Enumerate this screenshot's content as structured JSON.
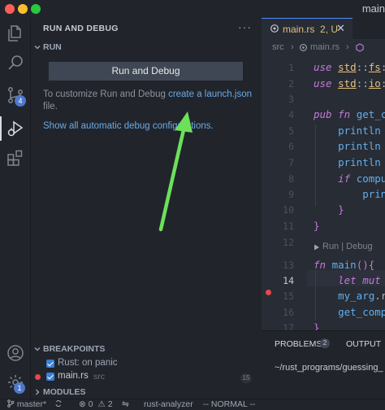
{
  "window": {
    "title": "main"
  },
  "activity": {
    "scm_badge": "4",
    "account_badge": "1"
  },
  "sidebar": {
    "header": "RUN AND DEBUG",
    "more": "···",
    "run_section": "RUN",
    "run_button": "Run and Debug",
    "desc_prefix": "To customize Run and Debug ",
    "desc_link": "create a launch.json",
    "desc_suffix": "file.",
    "show_link": "Show all automatic debug configurations.",
    "breakpoints_section": "BREAKPOINTS",
    "breakpoints": [
      {
        "label": "Rust: on panic",
        "checked": true
      },
      {
        "label": "main.rs",
        "path": "src",
        "line": "15",
        "checked": true
      }
    ],
    "modules_section": "MODULES"
  },
  "editor": {
    "tab": {
      "label": "main.rs",
      "status": "2, U",
      "close": "✕"
    },
    "breadcrumb": {
      "folder": "src",
      "sep": "›",
      "file": "main.rs",
      "sep2": "›"
    },
    "code_lens": "Run | Debug",
    "lines": [
      {
        "num": "1",
        "text": "use std::fs::"
      },
      {
        "num": "2",
        "text": "use std::io::"
      },
      {
        "num": "3",
        "text": ""
      },
      {
        "num": "4",
        "text": "pub fn get_c"
      },
      {
        "num": "5",
        "text": "    println"
      },
      {
        "num": "6",
        "text": "    println"
      },
      {
        "num": "7",
        "text": "    println"
      },
      {
        "num": "8",
        "text": "    if compu"
      },
      {
        "num": "9",
        "text": "        prin"
      },
      {
        "num": "10",
        "text": "    }"
      },
      {
        "num": "11",
        "text": "}"
      },
      {
        "num": "12",
        "text": ""
      },
      {
        "num": "13",
        "text": "fn main(){"
      },
      {
        "num": "14",
        "text": "    let mut"
      },
      {
        "num": "15",
        "text": "    my_arg.r"
      },
      {
        "num": "16",
        "text": "    get_comp"
      },
      {
        "num": "17",
        "text": "}"
      }
    ]
  },
  "panel": {
    "problems": "PROBLEMS",
    "problems_count": "2",
    "output": "OUTPUT",
    "terminal": "~/rust_programs/guessing_"
  },
  "status": {
    "branch": "master*",
    "errors": "0",
    "warnings": "2",
    "analyzer": "rust-analyzer",
    "mode": "-- NORMAL --"
  },
  "colors": {
    "accent": "#528bff",
    "link": "#6ba9e7",
    "arrow": "#6de05a",
    "breakpoint": "#e5484d"
  }
}
